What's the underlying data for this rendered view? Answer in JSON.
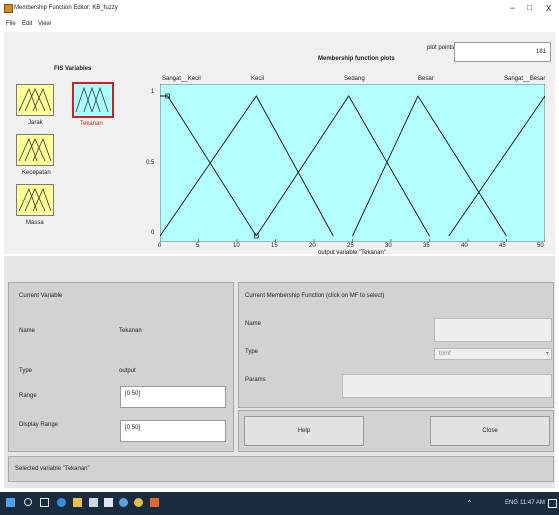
{
  "window": {
    "title": "Membership Function Editor: KB_fuzzy",
    "minimize": "−",
    "restore": "□",
    "close": "X"
  },
  "menu": {
    "items": [
      "File",
      "Edit",
      "View"
    ]
  },
  "fis_panel": {
    "title": "FIS Variables",
    "variables": [
      {
        "label": "Jarak",
        "selected": false
      },
      {
        "label": "Tekanan",
        "selected": true
      },
      {
        "label": "Kecepatan",
        "selected": false
      },
      {
        "label": "Massa",
        "selected": false
      }
    ]
  },
  "plot": {
    "title": "Membership function plots",
    "plot_points_label": "plot points:",
    "plot_points_value": "181",
    "xlabel": "output variable \"Tekanan\"",
    "mf_labels": [
      "Sangat__Kecil",
      "Kecil",
      "Sedang",
      "Besar",
      "Sangat__Besar"
    ],
    "y_ticks": [
      "1",
      "0.5",
      "0"
    ],
    "x_ticks": [
      "0",
      "5",
      "10",
      "15",
      "20",
      "25",
      "30",
      "35",
      "40",
      "45",
      "50"
    ]
  },
  "chart_data": {
    "type": "line",
    "title": "Membership function plots",
    "xlabel": "output variable \"Tekanan\"",
    "xlim": [
      0,
      50
    ],
    "ylim": [
      0,
      1
    ],
    "series": [
      {
        "name": "Sangat__Kecil",
        "x": [
          0,
          1,
          12.5
        ],
        "values": [
          1,
          1,
          0
        ]
      },
      {
        "name": "Kecil",
        "x": [
          0,
          12.5,
          22.5
        ],
        "values": [
          0,
          1,
          0
        ]
      },
      {
        "name": "Sedang",
        "x": [
          12.5,
          24.5,
          35
        ],
        "values": [
          0,
          1,
          0
        ]
      },
      {
        "name": "Besar",
        "x": [
          25,
          33.5,
          45
        ],
        "values": [
          0,
          1,
          0
        ]
      },
      {
        "name": "Sangat__Besar",
        "x": [
          37.5,
          50
        ],
        "values": [
          0,
          1
        ]
      }
    ],
    "background": "#b3ffff"
  },
  "current_variable": {
    "heading": "Current Variable",
    "name_label": "Name",
    "name_value": "Tekanan",
    "type_label": "Type",
    "type_value": "output",
    "range_label": "Range",
    "range_value": "[0 50]",
    "display_range_label": "Display Range",
    "display_range_value": "[0 50]"
  },
  "current_mf": {
    "heading": "Current Membership Function (click on MF to select)",
    "name_label": "Name",
    "type_label": "Type",
    "type_value": "trimf",
    "params_label": "Params",
    "help_label": "Help",
    "close_label": "Close"
  },
  "status": {
    "text": "Selected variable \"Tekanan\""
  },
  "taskbar": {
    "tray": "ENG",
    "time": "11:47 AM"
  },
  "colors": {
    "fis_input": "#ffff99",
    "fis_output": "#aaffff",
    "selection": "#d21e1e",
    "plot_bg": "#b3ffff"
  }
}
